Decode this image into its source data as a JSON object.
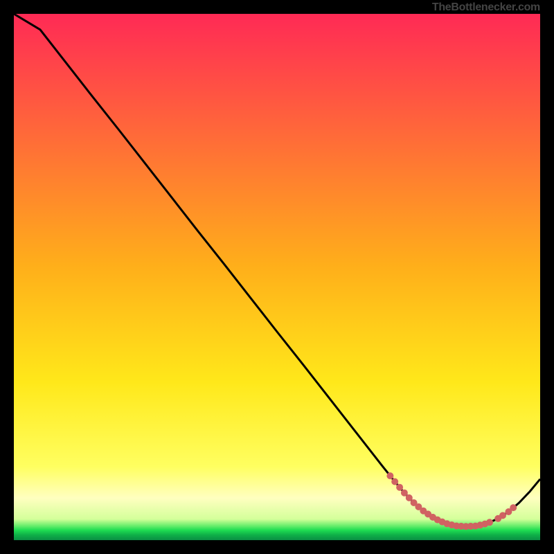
{
  "attribution": "TheBottlenecker.com",
  "colors": {
    "bg_black": "#000000",
    "grad_top": "#ff2a55",
    "grad_mid": "#ffd21a",
    "grad_stripe_pale": "#ffffa0",
    "grad_green": "#1fdd52",
    "line": "#000000",
    "knot": "#d06262"
  },
  "chart_data": {
    "type": "line",
    "title": "",
    "xlabel": "",
    "ylabel": "",
    "xlim": [
      0,
      100
    ],
    "ylim": [
      0,
      100
    ],
    "x": [
      0,
      5,
      10,
      15,
      20,
      25,
      30,
      35,
      40,
      45,
      50,
      55,
      60,
      65,
      70,
      72,
      74,
      76,
      78,
      80,
      82,
      84,
      86,
      88,
      90,
      92,
      94,
      96,
      98,
      100
    ],
    "y": [
      100,
      97,
      90.6,
      84.2,
      77.9,
      71.5,
      65.1,
      58.7,
      52.4,
      46.0,
      39.6,
      33.3,
      26.9,
      20.5,
      14.1,
      11.6,
      9.2,
      7.1,
      5.4,
      4.1,
      3.2,
      2.7,
      2.6,
      2.7,
      3.2,
      4.1,
      5.4,
      7.1,
      9.2,
      11.6
    ],
    "knot_segments": [
      {
        "x0": 71.5,
        "x1": 90.5,
        "thick": true
      },
      {
        "x0": 92.0,
        "x1": 93.0,
        "thick": true
      },
      {
        "x0": 94.0,
        "x1": 95.0,
        "thick": true
      }
    ]
  }
}
